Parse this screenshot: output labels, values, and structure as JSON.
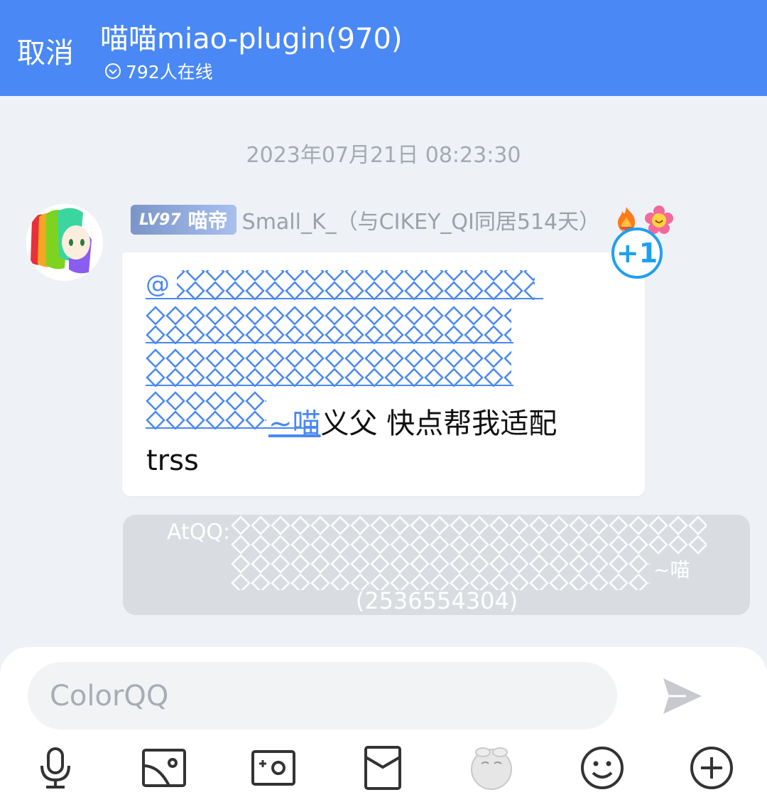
{
  "header": {
    "cancel_label": "取消",
    "title": "喵喵miao-plugin(970)",
    "online_text": "792人在线"
  },
  "conversation": {
    "timestamp": "2023年07月21日 08:23:30",
    "message": {
      "level_badge": "LV97",
      "rank_title": "喵帝",
      "sender_name": "Small_K_（与CIKEY_QI同居514天）",
      "mention_prefix": "@",
      "mention_suffix": "~喵",
      "text_after_mention": "义父 快点帮我适配",
      "text_line2": "trss",
      "reaction_label": "+1"
    },
    "system_notice": {
      "line1": "AtQQ:",
      "line2_tail": "~喵",
      "line3": "(2536554304)"
    }
  },
  "composer": {
    "placeholder": "ColorQQ"
  },
  "toolbar": {
    "icons": [
      "microphone-icon",
      "image-icon",
      "camera-icon",
      "red-packet-icon",
      "emoji-sticker-icon",
      "smiley-icon",
      "plus-icon"
    ]
  },
  "colors": {
    "header_bg": "#4a88f5",
    "mention_blue": "#4a88f5",
    "reaction_blue": "#1ea0f0",
    "system_bubble": "#d9dde1"
  }
}
